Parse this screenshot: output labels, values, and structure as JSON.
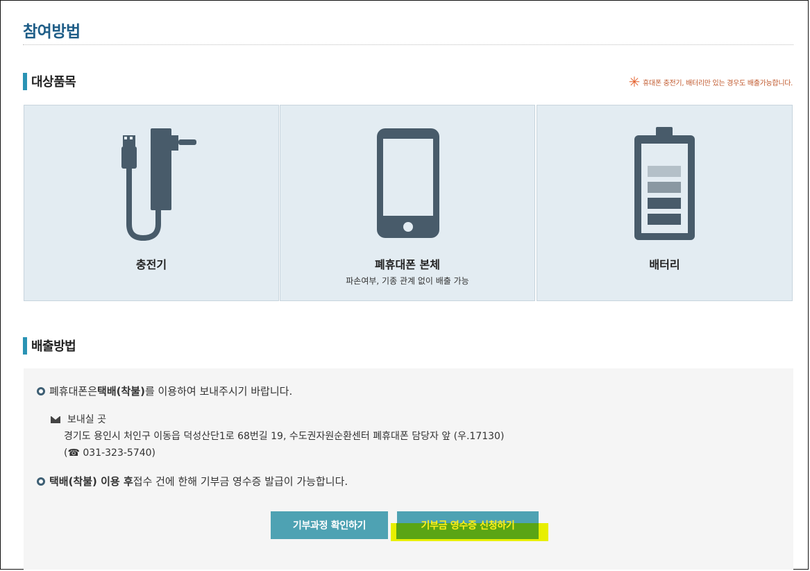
{
  "page": {
    "title": "참여방법"
  },
  "items_section": {
    "title": "대상품목",
    "note_icon": "asterisk-icon",
    "note": "휴대폰 충전기, 배터리만 있는 경우도 배출가능합니다.",
    "cards": [
      {
        "icon": "charger-icon",
        "title": "충전기",
        "subtitle": ""
      },
      {
        "icon": "phone-icon",
        "title": "폐휴대폰 본체",
        "subtitle": "파손여부, 기종 관계 없이 배출 가능"
      },
      {
        "icon": "battery-icon",
        "title": "배터리",
        "subtitle": ""
      }
    ]
  },
  "disposal_section": {
    "title": "배출방법",
    "line1_prefix": "폐휴대폰은 ",
    "line1_bold": "택배(착불)",
    "line1_suffix": "를 이용하여 보내주시기 바랍니다.",
    "address_label": "보내실 곳",
    "address": "경기도 용인시 처인구 이동읍 덕성산단1로 68번길 19,  수도권자원순환센터 폐휴대폰 담당자 앞 (우.17130)",
    "phone_prefix": "(",
    "phone": "031-323-5740)",
    "line2_bold": "택배(착불) 이용 후",
    "line2_suffix": " 접수 건에 한해 기부금 영수증 발급이 가능합니다.",
    "buttons": {
      "process": "기부과정 확인하기",
      "receipt": "기부금 영수증 신청하기"
    }
  },
  "colors": {
    "title": "#1e5d87",
    "accent_bar": "#2a93b4",
    "card_bg": "#e3ecf2",
    "icon": "#485b6a",
    "button": "#4ea2b3",
    "note": "#c0582c"
  }
}
